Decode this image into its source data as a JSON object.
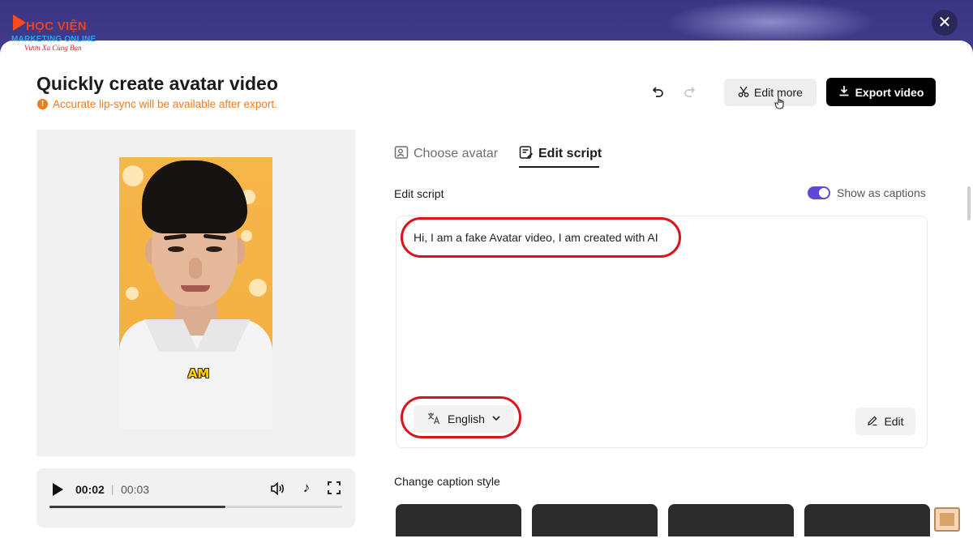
{
  "logo": {
    "line1": "HỌC VIỆN",
    "line2": "MARKETING ONLINE",
    "line3": "Vươn Xa Cùng Bạn"
  },
  "close_label": "✕",
  "header": {
    "title": "Quickly create avatar video",
    "notice": "Accurate lip-sync will be available after export.",
    "edit_more_label": "Edit more",
    "export_label": "Export video"
  },
  "preview": {
    "caption_word": "AM"
  },
  "player": {
    "current_time": "00:02",
    "separator": "|",
    "total_time": "00:03",
    "progress": 0.6
  },
  "tabs": [
    {
      "label": "Choose avatar",
      "active": false
    },
    {
      "label": "Edit script",
      "active": true
    }
  ],
  "script_panel": {
    "section_label": "Edit script",
    "captions_label": "Show as captions",
    "captions_enabled": true,
    "script_text": "Hi, I am a fake Avatar video, I am created with AI",
    "language": "English",
    "edit_label": "Edit"
  },
  "caption_style": {
    "label": "Change caption style",
    "card_count": 4
  },
  "colors": {
    "accent": "#5b4ad6",
    "warning": "#f07b1c",
    "highlight": "#d9141b",
    "export_bg": "#000000"
  },
  "icons": [
    "close-icon",
    "warning-icon",
    "undo-icon",
    "redo-icon",
    "scissors-icon",
    "download-icon",
    "play-icon",
    "volume-icon",
    "tiktok-icon",
    "fullscreen-icon",
    "avatar-tab-icon",
    "script-tab-icon",
    "translate-icon",
    "chevron-down-icon",
    "pencil-icon"
  ]
}
